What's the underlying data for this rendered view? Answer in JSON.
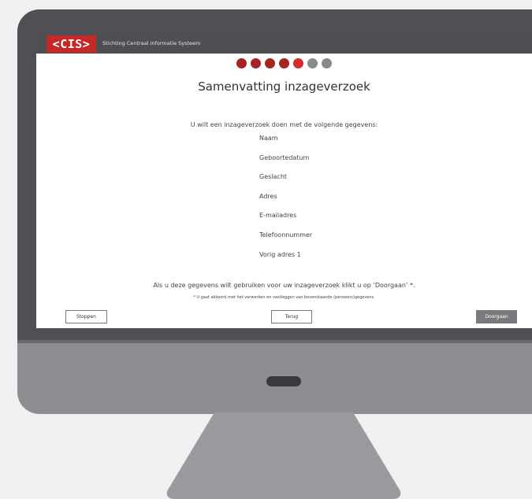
{
  "app": {
    "logo_text": "<CIS>",
    "org_name": "Stichting Centraal Informatie Systeem"
  },
  "progress": {
    "total_steps": 7,
    "completed_steps": 5,
    "done_color": "#a82424",
    "current_color": "#d62c2c",
    "pending_color": "#8a8a8e"
  },
  "page": {
    "title": "Samenvatting inzageverzoek",
    "intro": "U wilt een inzageverzoek doen met de volgende gegevens:",
    "fields": [
      "Naam",
      "Geboortedatum",
      "Geslacht",
      "Adres",
      "E-mailadres",
      "Telefoonnummer",
      "Vorig adres 1"
    ],
    "confirm": "Als u deze gegevens wilt gebruiken voor uw inzageverzoek klikt u op ‘Doorgaan’ *.",
    "disclaimer": "* U gaat akkoord met het verwerken en vastleggen van bovenstaande (persoons)gegevens."
  },
  "buttons": {
    "stop": "Stoppen",
    "back": "Terug",
    "next": "Doorgaan"
  },
  "colors": {
    "brand_red": "#c62828",
    "header_bg": "#4f4f53",
    "primary_button": "#7a7a7e"
  }
}
